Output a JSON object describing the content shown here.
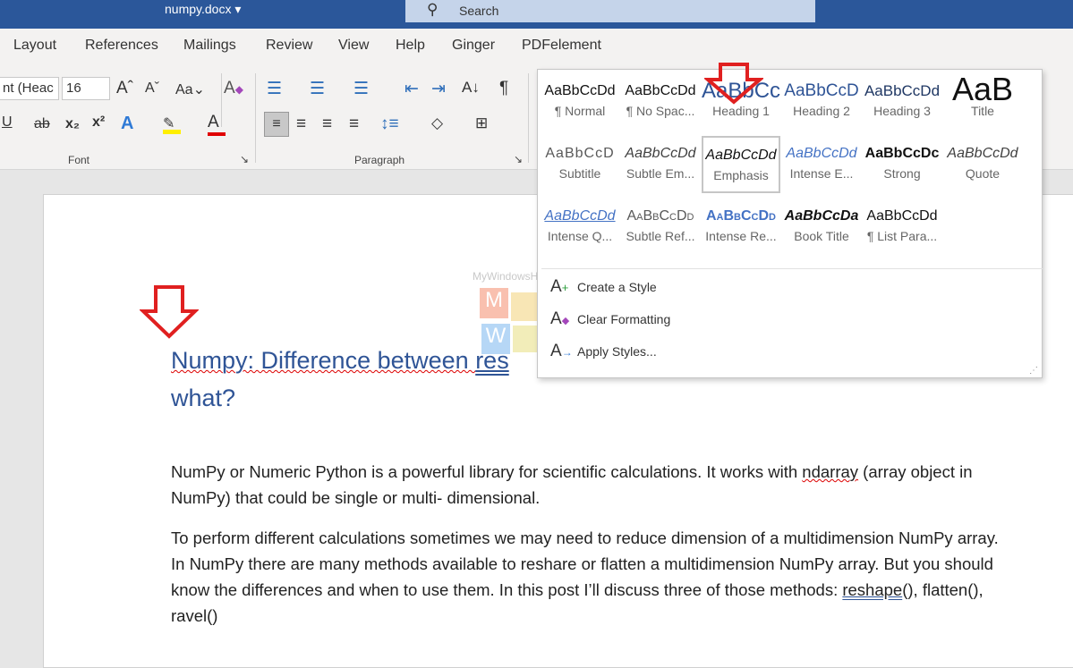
{
  "titlebar": {
    "document": "numpy.docx",
    "dropdown": "▾",
    "search_label": "Search"
  },
  "tabs": [
    "Layout",
    "References",
    "Mailings",
    "Review",
    "View",
    "Help",
    "Ginger",
    "PDFelement"
  ],
  "ribbon": {
    "font_name": "nt (Heac",
    "font_size": "16",
    "groups": {
      "font": "Font",
      "paragraph": "Paragraph"
    }
  },
  "styles_gallery": [
    {
      "preview": "AaBbCcDd",
      "name": "¶ Normal"
    },
    {
      "preview": "AaBbCcDd",
      "name": "¶ No Spac..."
    },
    {
      "preview": "AaBbCc",
      "name": "Heading 1"
    },
    {
      "preview": "AaBbCcD",
      "name": "Heading 2"
    },
    {
      "preview": "AaBbCcDd",
      "name": "Heading 3"
    },
    {
      "preview": "AaB",
      "name": "Title"
    },
    {
      "preview": "AaBbCcD",
      "name": "Subtitle"
    },
    {
      "preview": "AaBbCcDd",
      "name": "Subtle Em..."
    },
    {
      "preview": "AaBbCcDd",
      "name": "Emphasis"
    },
    {
      "preview": "AaBbCcDd",
      "name": "Intense E..."
    },
    {
      "preview": "AaBbCcDc",
      "name": "Strong"
    },
    {
      "preview": "AaBbCcDd",
      "name": "Quote"
    },
    {
      "preview": "AaBbCcDd",
      "name": "Intense Q..."
    },
    {
      "preview": "AaBbCcDd",
      "name": "Subtle Ref..."
    },
    {
      "preview": "AaBbCcDd",
      "name": "Intense Re..."
    },
    {
      "preview": "AaBbCcDa",
      "name": "Book Title"
    },
    {
      "preview": "AaBbCcDd",
      "name": "¶ List Para..."
    }
  ],
  "selected_style": "Emphasis",
  "actions": [
    "Create a Style",
    "Clear Formatting",
    "Apply Styles..."
  ],
  "document": {
    "heading_line1_pre": "Numpy: Difference between ",
    "heading_line1_post": "res",
    "heading_line2": "what?",
    "p1a": "NumPy or Numeric Python is a powerful library for scientific calculations. It works with ",
    "p1_err": "ndarray",
    "p1b": " (array object in NumPy) that could be single or multi- dimensional.",
    "p2a": "To perform different calculations sometimes we may need to reduce dimension of a multidimension NumPy array. In NumPy there are many methods available to reshare or flatten a multidimension NumPy array. But you should know the differences and when to use them. In this post I’ll discuss three of those methods: ",
    "p2_link": "reshape",
    "p2b": "(), flatten(), ravel()"
  },
  "watermark": "MyWindowsHub.com",
  "colors": {
    "titlebar": "#2b579a",
    "heading": "#2f5496",
    "arrow": "#e02020"
  }
}
